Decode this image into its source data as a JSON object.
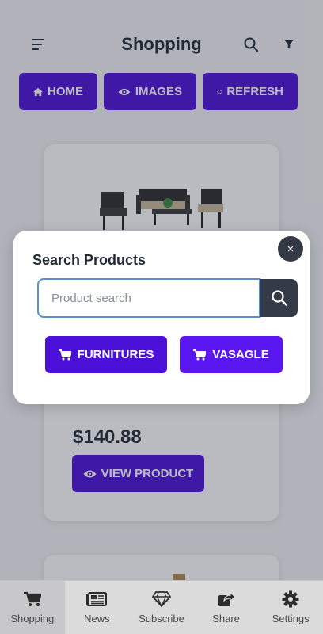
{
  "header": {
    "title": "Shopping",
    "icons": [
      "menu-icon",
      "search-icon",
      "filter-icon"
    ]
  },
  "topnav": {
    "home": "HOME",
    "images": "IMAGES",
    "refresh": "REFRESH"
  },
  "product": {
    "price": "$140.88",
    "view_label": "VIEW PRODUCT"
  },
  "modal": {
    "title": "Search Products",
    "close_glyph": "×",
    "search_placeholder": "Product search",
    "categories": [
      "FURNITURES",
      "VASAGLE"
    ]
  },
  "bottomnav": {
    "items": [
      {
        "label": "Shopping",
        "icon": "cart-icon",
        "active": true
      },
      {
        "label": "News",
        "icon": "newspaper-icon",
        "active": false
      },
      {
        "label": "Subscribe",
        "icon": "diamond-icon",
        "active": false
      },
      {
        "label": "Share",
        "icon": "share-icon",
        "active": false
      },
      {
        "label": "Settings",
        "icon": "gear-icon",
        "active": false
      }
    ]
  },
  "colors": {
    "accent": "#4a10d8",
    "accent_light": "#5a16f0",
    "dark": "#333a45"
  }
}
